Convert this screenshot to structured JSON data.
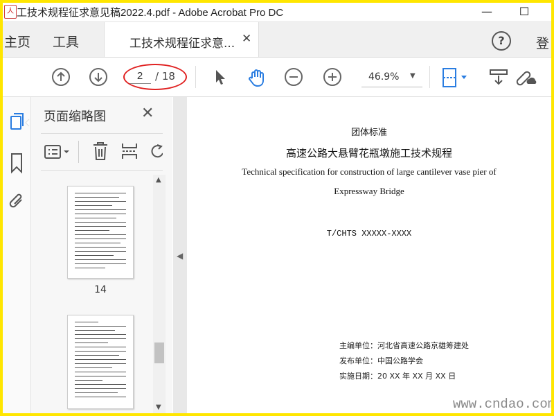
{
  "window": {
    "title": "工技术规程征求意见稿2022.4.pdf - Adobe Acrobat Pro DC",
    "minimize_glyph": "—",
    "maximize_glyph": "☐"
  },
  "tabs": {
    "home": "主页",
    "tools": "工具",
    "document": "工技术规程征求意...",
    "close_glyph": "✕"
  },
  "header_right": {
    "help_glyph": "?",
    "signin": "登"
  },
  "toolbar": {
    "current_page": "2",
    "total_pages": "/ 18",
    "zoom": "46.9%"
  },
  "thumbnail_panel": {
    "title": "页面缩略图",
    "close_glyph": "✕",
    "thumbnails": [
      {
        "label": "14"
      }
    ]
  },
  "document": {
    "org": "团体标准",
    "title_cn": "高速公路大悬臂花瓶墩施工技术规程",
    "title_en_line1": "Technical specification for construction of large cantilever vase pier of",
    "title_en_line2": "Expressway Bridge",
    "code": "T/CHTS XXXXX-XXXX",
    "editor": "主编单位：河北省高速公路京雄筹建处",
    "publisher": "发布单位：中国公路学会",
    "effective_date": "实施日期：20 XX 年 XX 月 XX 日"
  },
  "watermark": "www.cndao.com",
  "colors": {
    "frame": "#ffe600",
    "accent_blue": "#2a7de1",
    "annotation_red": "#e02020"
  },
  "icons": [
    "back-arrow-up-icon",
    "next-arrow-down-icon",
    "pointer-icon",
    "hand-icon",
    "zoom-out-icon",
    "zoom-in-icon",
    "fit-page-icon",
    "scan-icon",
    "link-cloud-icon",
    "thumbnails-icon",
    "bookmark-icon",
    "attachment-icon",
    "options-icon",
    "delete-icon",
    "insert-icon",
    "rotate-icon"
  ]
}
